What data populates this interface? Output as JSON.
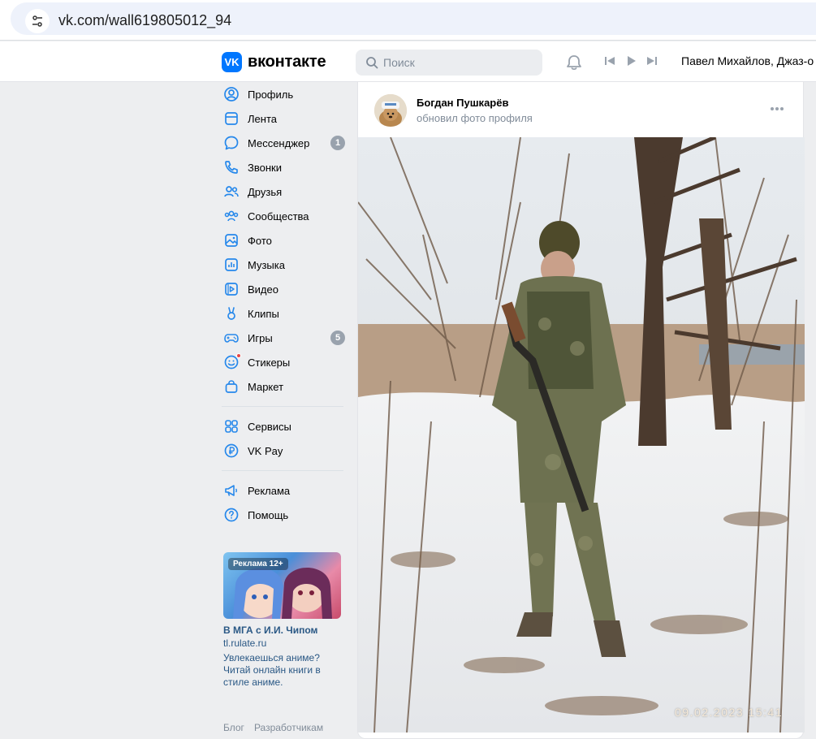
{
  "browser": {
    "url": "vk.com/wall619805012_94"
  },
  "header": {
    "logo_mark": "VK",
    "logo_text": "вконтакте",
    "search_placeholder": "Поиск",
    "now_playing": "Павел Михайлов, Джаз-о"
  },
  "nav": {
    "items": [
      {
        "label": "Профиль",
        "icon": "profile-icon"
      },
      {
        "label": "Лента",
        "icon": "feed-icon"
      },
      {
        "label": "Мессенджер",
        "icon": "messenger-icon",
        "badge": "1"
      },
      {
        "label": "Звонки",
        "icon": "phone-icon"
      },
      {
        "label": "Друзья",
        "icon": "friends-icon"
      },
      {
        "label": "Сообщества",
        "icon": "communities-icon"
      },
      {
        "label": "Фото",
        "icon": "photo-icon"
      },
      {
        "label": "Музыка",
        "icon": "music-icon"
      },
      {
        "label": "Видео",
        "icon": "video-icon"
      },
      {
        "label": "Клипы",
        "icon": "clips-icon"
      },
      {
        "label": "Игры",
        "icon": "games-icon",
        "badge": "5"
      },
      {
        "label": "Стикеры",
        "icon": "stickers-icon"
      },
      {
        "label": "Маркет",
        "icon": "market-icon"
      }
    ],
    "items2": [
      {
        "label": "Сервисы",
        "icon": "services-icon"
      },
      {
        "label": "VK Pay",
        "icon": "vkpay-icon"
      }
    ],
    "items3": [
      {
        "label": "Реклама",
        "icon": "megaphone-icon"
      },
      {
        "label": "Помощь",
        "icon": "help-icon"
      }
    ]
  },
  "ad": {
    "badge": "Реклама 12+",
    "title": "В МГА с И.И. Чипом",
    "domain": "tl.rulate.ru",
    "description": "Увлекаешься аниме? Читай онлайн книги в стиле аниме."
  },
  "footer": {
    "blog": "Блог",
    "developers": "Разработчикам"
  },
  "post": {
    "author": "Богдан Пушкарёв",
    "subtitle": "обновил фото профиля",
    "photo_date": "09.02.2023  15:41"
  },
  "colors": {
    "accent": "#0077ff",
    "link": "#2a5885",
    "muted": "#818c99",
    "badge": "#99a2ad",
    "nav_icon": "#2688eb",
    "background": "#edeef0"
  }
}
